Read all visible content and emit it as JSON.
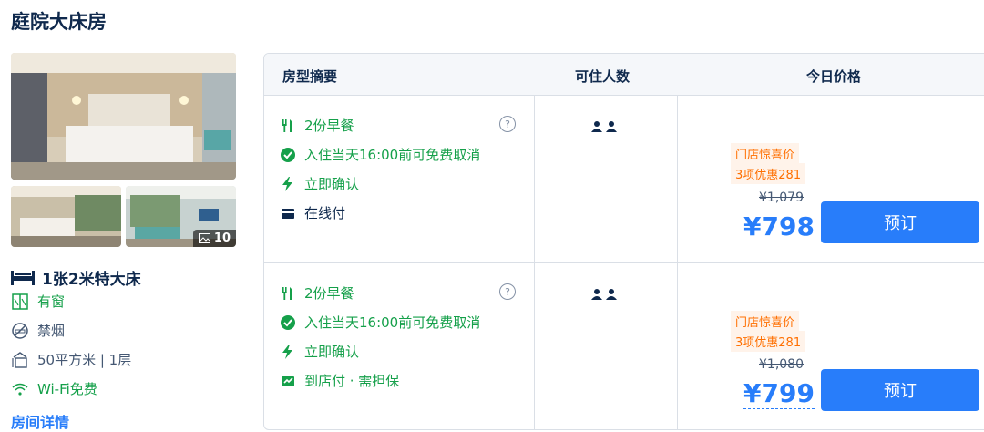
{
  "room": {
    "title": "庭院大床房",
    "photo_count": "10",
    "bed": "1张2米特大床",
    "features": {
      "window": "有窗",
      "smoking": "禁烟",
      "area": "50平方米 | 1层",
      "wifi": "Wi-Fi免费"
    },
    "details_link": "房间详情"
  },
  "table": {
    "headers": {
      "summary": "房型摘要",
      "guests": "可住人数",
      "price": "今日价格"
    },
    "rows": [
      {
        "breakfast": "2份早餐",
        "cancel": "入住当天16:00前可免费取消",
        "confirm": "立即确认",
        "payment": "在线付",
        "promo_label": "门店惊喜价",
        "promo_detail": "3项优惠281",
        "original_price": "¥1,079",
        "price": "¥798",
        "book": "预订"
      },
      {
        "breakfast": "2份早餐",
        "cancel": "入住当天16:00前可免费取消",
        "confirm": "立即确认",
        "payment": "到店付 · 需担保",
        "promo_label": "门店惊喜价",
        "promo_detail": "3项优惠281",
        "original_price": "¥1,080",
        "price": "¥799",
        "book": "预订"
      }
    ],
    "help_glyph": "?"
  },
  "colors": {
    "accent": "#287dfa",
    "green": "#15a04a",
    "promo": "#ff6f00",
    "text": "#0f294d"
  },
  "icons": {
    "bed": "bed-icon",
    "window": "window-icon",
    "smoking": "no-smoking-icon",
    "area": "area-icon",
    "wifi": "wifi-icon",
    "breakfast": "cutlery-icon",
    "cancel": "check-circle-icon",
    "confirm": "lightning-icon",
    "online_pay": "card-icon",
    "store_pay": "guarantee-card-icon",
    "guest": "person-icon",
    "photos": "image-icon"
  }
}
